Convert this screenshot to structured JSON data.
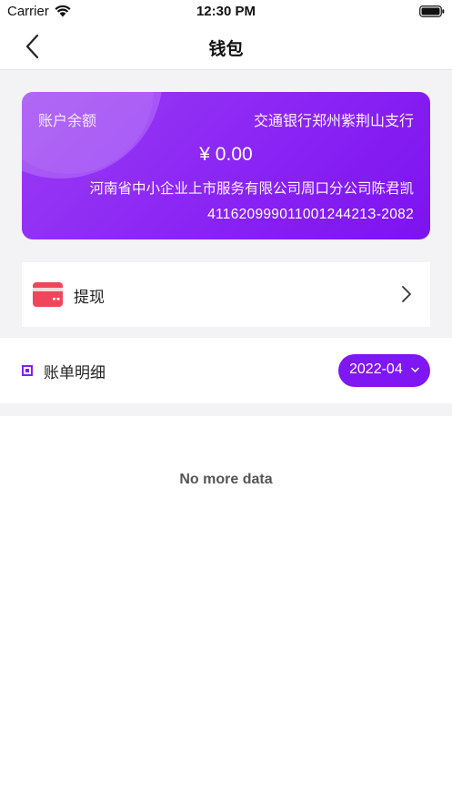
{
  "status_bar": {
    "carrier": "Carrier",
    "time": "12:30 PM"
  },
  "nav": {
    "title": "钱包"
  },
  "balance_card": {
    "label": "账户余额",
    "bank": "交通银行郑州紫荆山支行",
    "amount": "¥ 0.00",
    "company": "河南省中小企业上市服务有限公司周口分公司陈君凯",
    "account_number": "41162099901100124421З-2082"
  },
  "withdraw": {
    "label": "提现"
  },
  "bill": {
    "title": "账单明细",
    "month": "2022-04"
  },
  "list": {
    "empty_text": "No more data"
  },
  "colors": {
    "accent": "#7f17f2",
    "card_gradient_start": "#9a3cf3",
    "card_gradient_end": "#7d12f0",
    "card_icon": "#f0455a",
    "background": "#f3f3f5"
  }
}
